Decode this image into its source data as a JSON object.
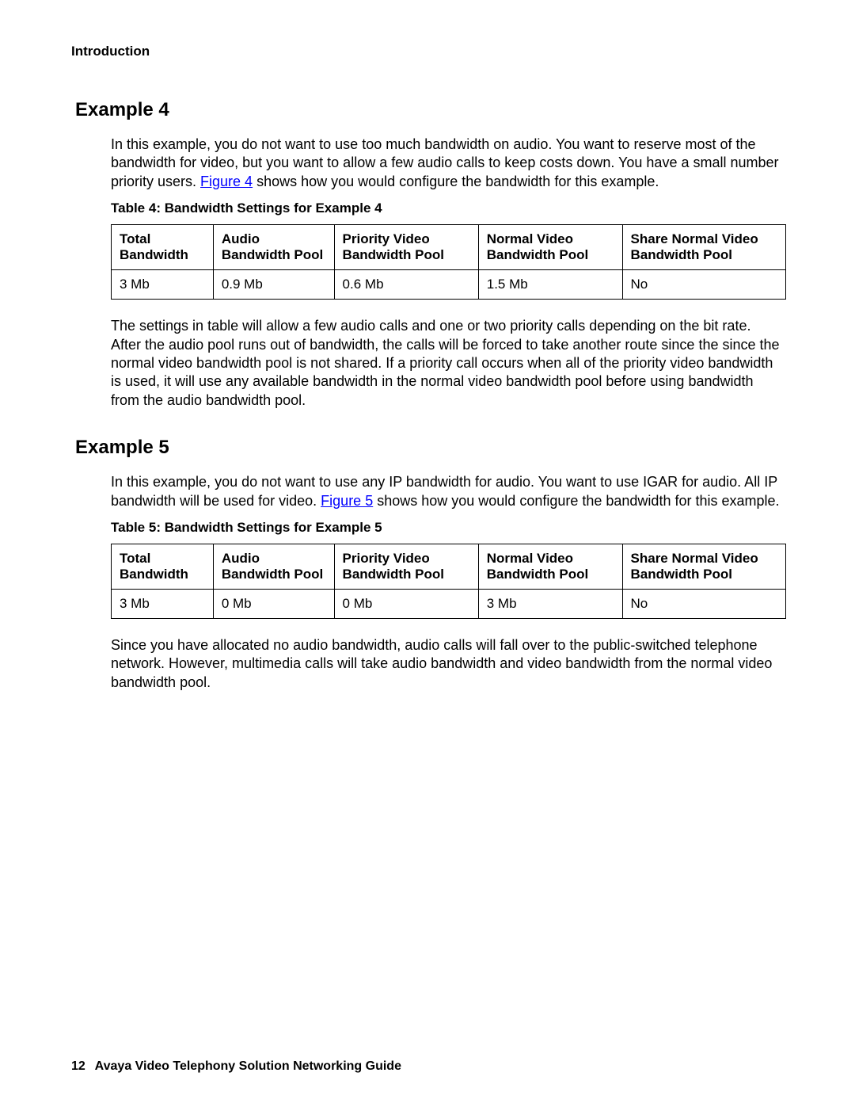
{
  "header": {
    "label": "Introduction"
  },
  "example4": {
    "heading": "Example 4",
    "intro_pre": "In this example, you do not want to use too much bandwidth on audio. You want to reserve most of the bandwidth for video, but you want to allow a few audio calls to keep costs down. You have a small number priority users. ",
    "link_text": "Figure 4",
    "intro_post": " shows how you would configure the bandwidth for this example.",
    "table_caption": "Table 4: Bandwidth Settings for Example 4",
    "headers": {
      "c1": "Total Bandwidth",
      "c2": "Audio Bandwidth Pool",
      "c3": "Priority Video Bandwidth Pool",
      "c4": "Normal Video Bandwidth Pool",
      "c5": "Share Normal Video Bandwidth Pool"
    },
    "row": {
      "c1": "3 Mb",
      "c2": "0.9 Mb",
      "c3": "0.6 Mb",
      "c4": "1.5 Mb",
      "c5": "No"
    },
    "after": "The settings in table will allow a few audio calls and one or two priority calls depending on the bit rate. After the audio pool runs out of bandwidth, the calls will be forced to take another route since the since the normal video bandwidth pool is not shared. If a priority call occurs when all of the priority video bandwidth is used, it will use any available bandwidth in the normal video bandwidth pool before using bandwidth from the audio bandwidth pool."
  },
  "example5": {
    "heading": "Example 5",
    "intro_pre": "In this example, you do not want to use any IP bandwidth for audio. You want to use IGAR for audio. All IP bandwidth will be used for video. ",
    "link_text": "Figure 5",
    "intro_post": " shows how you would configure the bandwidth for this example.",
    "table_caption": "Table 5: Bandwidth Settings for Example 5",
    "headers": {
      "c1": "Total Bandwidth",
      "c2": "Audio Bandwidth Pool",
      "c3": "Priority Video Bandwidth Pool",
      "c4": "Normal Video Bandwidth Pool",
      "c5": "Share Normal Video Bandwidth Pool"
    },
    "row": {
      "c1": "3 Mb",
      "c2": "0 Mb",
      "c3": "0 Mb",
      "c4": "3 Mb",
      "c5": "No"
    },
    "after": "Since you have allocated no audio bandwidth, audio calls will fall over to the public-switched telephone network. However, multimedia calls will take audio bandwidth and video bandwidth from the normal video bandwidth pool."
  },
  "footer": {
    "page": "12",
    "title": "Avaya Video Telephony Solution Networking Guide"
  }
}
